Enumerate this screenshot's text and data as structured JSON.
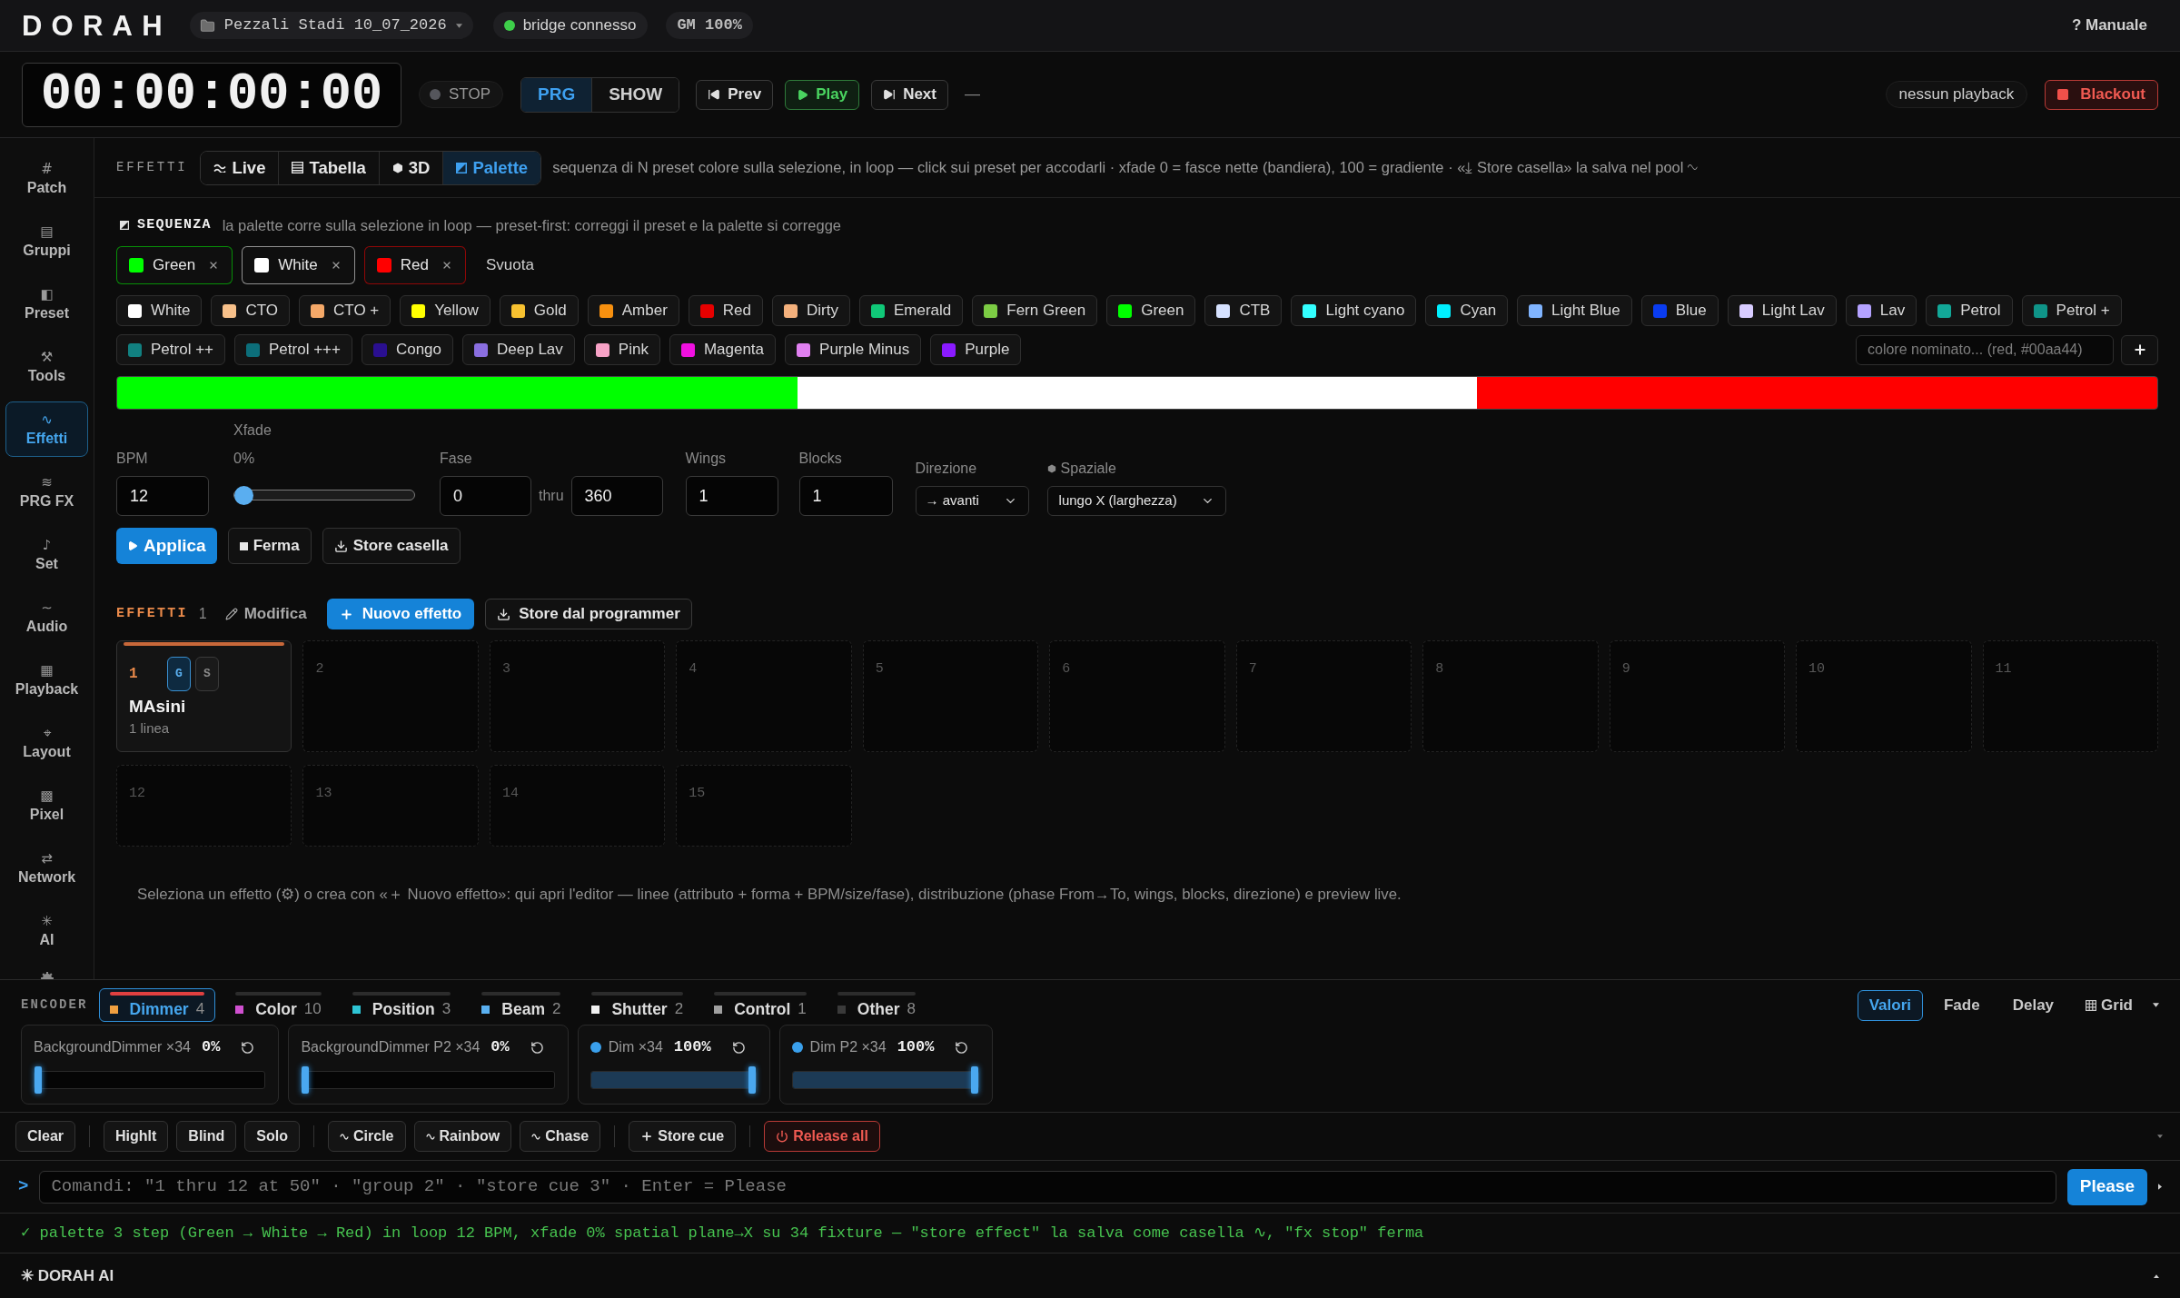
{
  "app": {
    "logo": "DORAH"
  },
  "top_bar": {
    "project": {
      "label": "Pezzali Stadi 10_07_2026"
    },
    "bridge": {
      "label": "bridge connesso",
      "connected": true
    },
    "grand_master": "GM 100%",
    "help": "? Manuale"
  },
  "transport": {
    "timecode": "00:00:00:00",
    "state": {
      "label": "STOP",
      "running": false
    },
    "modes": [
      {
        "label": "PRG",
        "selected": true
      },
      {
        "label": "SHOW",
        "selected": false
      }
    ],
    "buttons": [
      {
        "kind": "prev",
        "label": "Prev"
      },
      {
        "kind": "play",
        "label": "Play"
      },
      {
        "kind": "next",
        "label": "Next"
      }
    ],
    "current": "—",
    "playback": "nessun playback",
    "blackout": "Blackout"
  },
  "sidebar": {
    "items": [
      {
        "icon": "#",
        "label": "Patch",
        "selected": false
      },
      {
        "icon": "▤",
        "label": "Gruppi",
        "selected": false
      },
      {
        "icon": "◧",
        "label": "Preset",
        "selected": false
      },
      {
        "icon": "⚒",
        "label": "Tools",
        "selected": false
      },
      {
        "icon": "∿",
        "label": "Effetti",
        "selected": true
      },
      {
        "icon": "≋",
        "label": "PRG FX",
        "selected": false
      },
      {
        "icon": "♪",
        "label": "Set",
        "selected": false
      },
      {
        "icon": "∼",
        "label": "Audio",
        "selected": false
      },
      {
        "icon": "▦",
        "label": "Playback",
        "selected": false
      },
      {
        "icon": "⌖",
        "label": "Layout",
        "selected": false
      },
      {
        "icon": "▩",
        "label": "Pixel",
        "selected": false
      },
      {
        "icon": "⇄",
        "label": "Network",
        "selected": false
      },
      {
        "icon": "✳",
        "label": "AI",
        "selected": false
      }
    ]
  },
  "effects_header": {
    "title": "EFFETTI",
    "tabs": [
      {
        "label": "Live",
        "selected": false
      },
      {
        "label": "Tabella",
        "selected": false
      },
      {
        "label": "3D",
        "selected": false
      },
      {
        "label": "Palette",
        "selected": true
      }
    ],
    "description": "sequenza di N preset colore sulla selezione, in loop — click sui preset per accodarli · xfade 0 = fasce nette (bandiera), 100 = gradiente · «⤓ Store casella» la salva nel pool ∿"
  },
  "sequence": {
    "title": "SEQUENZA",
    "description": "la palette corre sulla selezione in loop — preset-first: correggi il preset e la palette si corregge",
    "steps": [
      {
        "name": "Green",
        "color": "#00ff00"
      },
      {
        "name": "White",
        "color": "#ffffff"
      },
      {
        "name": "Red",
        "color": "#ff0000"
      }
    ],
    "clear": "Svuota"
  },
  "palette": {
    "presets": [
      {
        "name": "White",
        "color": "#ffffff"
      },
      {
        "name": "CTO",
        "color": "#f7c08a"
      },
      {
        "name": "CTO +",
        "color": "#f4a868"
      },
      {
        "name": "Yellow",
        "color": "#ffff00"
      },
      {
        "name": "Gold",
        "color": "#f7c130"
      },
      {
        "name": "Amber",
        "color": "#f7900f"
      },
      {
        "name": "Red",
        "color": "#e60000"
      },
      {
        "name": "Dirty",
        "color": "#f3b07c"
      },
      {
        "name": "Emerald",
        "color": "#10c878"
      },
      {
        "name": "Fern Green",
        "color": "#7ccc44"
      },
      {
        "name": "Green",
        "color": "#00ff00"
      },
      {
        "name": "CTB",
        "color": "#d6e2ff"
      },
      {
        "name": "Light cyano",
        "color": "#33ffff"
      },
      {
        "name": "Cyan",
        "color": "#00f0ff"
      },
      {
        "name": "Light Blue",
        "color": "#80b4ff"
      },
      {
        "name": "Blue",
        "color": "#0a3cf0"
      },
      {
        "name": "Light Lav",
        "color": "#d8ccff"
      },
      {
        "name": "Lav",
        "color": "#b4a2ff"
      },
      {
        "name": "Petrol",
        "color": "#12a898"
      },
      {
        "name": "Petrol +",
        "color": "#0f9488"
      },
      {
        "name": "Petrol ++",
        "color": "#118080"
      },
      {
        "name": "Petrol +++",
        "color": "#0c6e7a"
      },
      {
        "name": "Congo",
        "color": "#2a0f90"
      },
      {
        "name": "Deep Lav",
        "color": "#8a6ee0"
      },
      {
        "name": "Pink",
        "color": "#f7a2c6"
      },
      {
        "name": "Magenta",
        "color": "#f010e0"
      },
      {
        "name": "Purple Minus",
        "color": "#e080f0"
      },
      {
        "name": "Purple",
        "color": "#8a1aff"
      }
    ],
    "custom_color": {
      "placeholder": "colore nominato... (red, #00aa44)"
    }
  },
  "parameters": {
    "bpm": {
      "label": "BPM",
      "value": "12"
    },
    "xfade": {
      "label": "Xfade",
      "reading": "0%",
      "level": 0
    },
    "phase": {
      "label": "Fase",
      "from": "0",
      "separator": "thru",
      "to": "360"
    },
    "wings": {
      "label": "Wings",
      "value": "1"
    },
    "blocks": {
      "label": "Blocks",
      "value": "1"
    },
    "direction": {
      "label": "Direzione",
      "value": "→ avanti"
    },
    "spatial": {
      "label": "Spaziale",
      "value": "lungo X (larghezza)"
    }
  },
  "actions": [
    {
      "kind": "apply",
      "label": "Applica"
    },
    {
      "kind": "stop",
      "label": "Ferma"
    },
    {
      "kind": "store",
      "label": "Store casella"
    }
  ],
  "effect_pool": {
    "title": "EFFETTI",
    "count": "1",
    "edit": "Modifica",
    "new": "Nuovo effetto",
    "store": "Store dal programmer",
    "slots": [
      {
        "kind": "effect",
        "number": "1",
        "name": "MAsini",
        "detail": "1 linea",
        "running": true,
        "flags": [
          {
            "label": "G",
            "on": true
          },
          {
            "label": "S",
            "on": false
          }
        ]
      },
      {
        "kind": "empty",
        "number": "2"
      },
      {
        "kind": "empty",
        "number": "3"
      },
      {
        "kind": "empty",
        "number": "4"
      },
      {
        "kind": "empty",
        "number": "5"
      },
      {
        "kind": "empty",
        "number": "6"
      },
      {
        "kind": "empty",
        "number": "7"
      },
      {
        "kind": "empty",
        "number": "8"
      },
      {
        "kind": "empty",
        "number": "9"
      },
      {
        "kind": "empty",
        "number": "10"
      },
      {
        "kind": "empty",
        "number": "11"
      },
      {
        "kind": "empty",
        "number": "12"
      },
      {
        "kind": "empty",
        "number": "13"
      },
      {
        "kind": "empty",
        "number": "14"
      },
      {
        "kind": "empty",
        "number": "15"
      }
    ],
    "hint": "Seleziona un effetto (⚙) o crea con «＋ Nuovo effetto»: qui apri l'editor — linee (attributo + forma + BPM/size/fase), distribuzione (phase From→To, wings, blocks, direzione) e preview live."
  },
  "encoder": {
    "title": "ENCODER",
    "tabs": [
      {
        "label": "Dimmer",
        "count": "4",
        "color": "#f0a040",
        "selected": true
      },
      {
        "label": "Color",
        "count": "10",
        "color": "#d050d0",
        "selected": false
      },
      {
        "label": "Position",
        "count": "3",
        "color": "#2ec4d4",
        "selected": false
      },
      {
        "label": "Beam",
        "count": "2",
        "color": "#5ab0f0",
        "selected": false
      },
      {
        "label": "Shutter",
        "count": "2",
        "color": "#f0f0f0",
        "selected": false
      },
      {
        "label": "Control",
        "count": "1",
        "color": "#a0a0a0",
        "selected": false
      },
      {
        "label": "Other",
        "count": "8",
        "color": "#3a3a3a",
        "selected": false
      }
    ],
    "views": [
      {
        "label": "Valori",
        "selected": true
      },
      {
        "label": "Fade",
        "selected": false
      },
      {
        "label": "Delay",
        "selected": false
      }
    ],
    "grid": "Grid",
    "channels": [
      {
        "label": "BackgroundDimmer ×34",
        "reading": "0%",
        "level": 0,
        "active": false
      },
      {
        "label": "BackgroundDimmer P2 ×34",
        "reading": "0%",
        "level": 0,
        "active": false
      },
      {
        "label": "Dim ×34",
        "reading": "100%",
        "level": 1,
        "active": true
      },
      {
        "label": "Dim P2 ×34",
        "reading": "100%",
        "level": 1,
        "active": true
      }
    ]
  },
  "toolbar": [
    {
      "kind": "clear",
      "label": "Clear"
    },
    {
      "kind": "mode",
      "label": "Highlt"
    },
    {
      "kind": "mode",
      "label": "Blind"
    },
    {
      "kind": "mode",
      "label": "Solo"
    },
    {
      "kind": "fx",
      "label": "Circle"
    },
    {
      "kind": "fx",
      "label": "Rainbow"
    },
    {
      "kind": "fx",
      "label": "Chase"
    },
    {
      "kind": "store",
      "label": "Store cue"
    },
    {
      "kind": "release",
      "label": "Release all"
    }
  ],
  "command_line": {
    "prompt": ">",
    "placeholder": "Comandi: \"1 thru 12 at 50\" · \"group 2\" · \"store cue 3\" · Enter = Please",
    "submit": "Please"
  },
  "status_message": "✓ palette 3 step (Green → White → Red) in loop 12 BPM, xfade 0% spatial plane→X su 34 fixture — \"store effect\" la salva come casella ∿, \"fx stop\" ferma",
  "ai_panel": {
    "title": "✳ DORAH AI"
  }
}
